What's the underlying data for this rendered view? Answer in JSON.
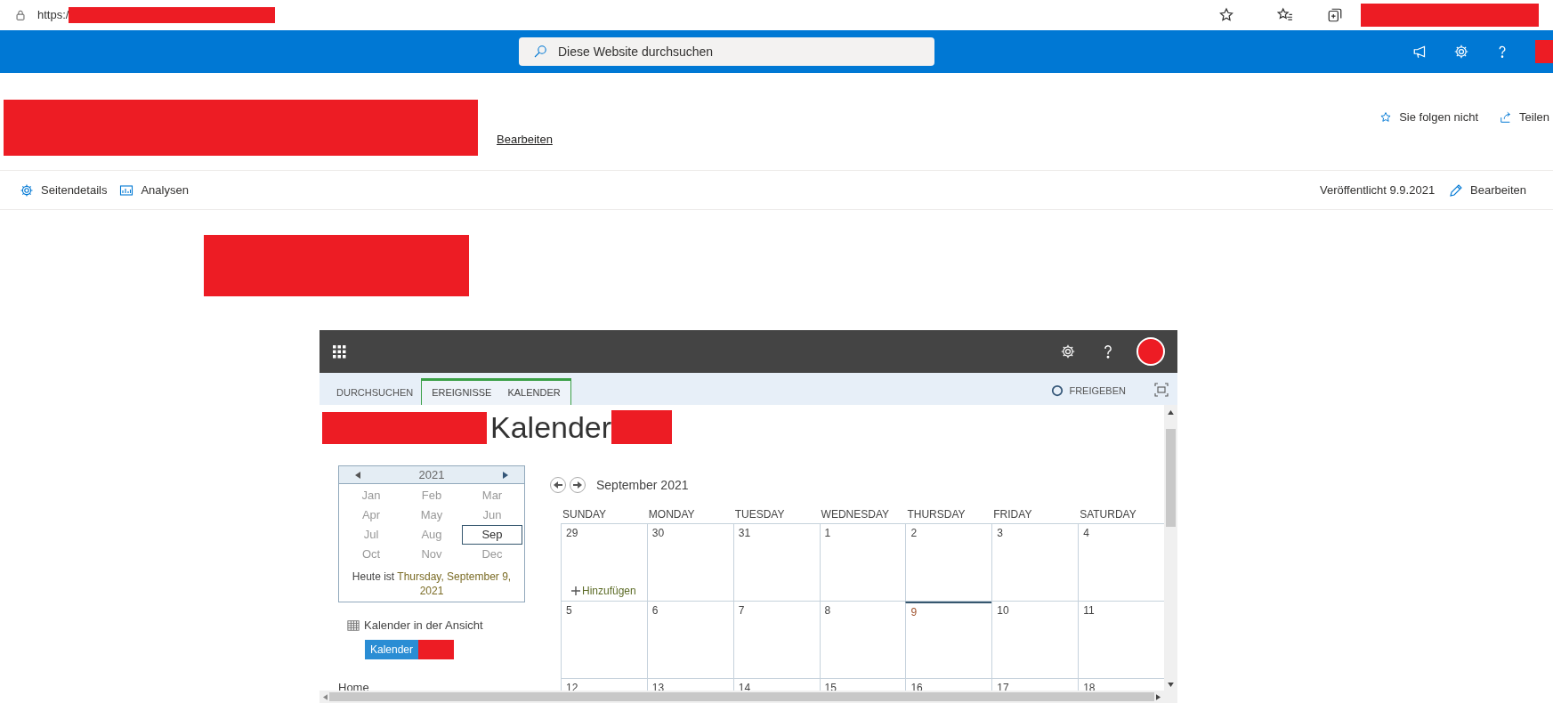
{
  "browser": {
    "url": "https:/"
  },
  "suite_bar": {
    "search_placeholder": "Diese Website durchsuchen"
  },
  "site_header": {
    "edit_link": "Bearbeiten",
    "follow": "Sie folgen nicht",
    "share": "Teilen"
  },
  "command_bar": {
    "items": [
      "Seitendetails",
      "Analysen"
    ],
    "published": "Veröffentlicht 9.9.2021",
    "edit": "Bearbeiten"
  },
  "app": {
    "tabs": [
      {
        "label": "DURCHSUCHEN",
        "contextual": false
      },
      {
        "label": "EREIGNISSE",
        "contextual": true
      },
      {
        "label": "KALENDER",
        "contextual": true
      }
    ],
    "share": "FREIGEBEN",
    "title": "Kalender",
    "year_picker": {
      "year": "2021",
      "months": [
        {
          "label": "Jan",
          "selected": false
        },
        {
          "label": "Feb",
          "selected": false
        },
        {
          "label": "Mar",
          "selected": false
        },
        {
          "label": "Apr",
          "selected": false
        },
        {
          "label": "May",
          "selected": false
        },
        {
          "label": "Jun",
          "selected": false
        },
        {
          "label": "Jul",
          "selected": false
        },
        {
          "label": "Aug",
          "selected": false
        },
        {
          "label": "Sep",
          "selected": true
        },
        {
          "label": "Oct",
          "selected": false
        },
        {
          "label": "Nov",
          "selected": false
        },
        {
          "label": "Dec",
          "selected": false
        }
      ],
      "today_prefix": "Heute ist",
      "today_date": "Thursday, September 9, 2021"
    },
    "views": {
      "heading": "Kalender in der Ansicht",
      "items": [
        {
          "label": "Kalender",
          "selected": true
        }
      ]
    },
    "nav": [
      "Home"
    ],
    "month": {
      "title": "September 2021",
      "weekdays": [
        "SUNDAY",
        "MONDAY",
        "TUESDAY",
        "WEDNESDAY",
        "THURSDAY",
        "FRIDAY",
        "SATURDAY"
      ],
      "weeks": [
        [
          {
            "day": "29",
            "today": false,
            "add_link": "Hinzufügen"
          },
          {
            "day": "30",
            "today": false
          },
          {
            "day": "31",
            "today": false
          },
          {
            "day": "1",
            "today": false
          },
          {
            "day": "2",
            "today": false
          },
          {
            "day": "3",
            "today": false
          },
          {
            "day": "4",
            "today": false
          }
        ],
        [
          {
            "day": "5",
            "today": false
          },
          {
            "day": "6",
            "today": false
          },
          {
            "day": "7",
            "today": false
          },
          {
            "day": "8",
            "today": false
          },
          {
            "day": "9",
            "today": true
          },
          {
            "day": "10",
            "today": false
          },
          {
            "day": "11",
            "today": false
          }
        ],
        [
          {
            "day": "12",
            "today": false
          },
          {
            "day": "13",
            "today": false
          },
          {
            "day": "14",
            "today": false
          },
          {
            "day": "15",
            "today": false
          },
          {
            "day": "16",
            "today": false
          },
          {
            "day": "17",
            "today": false
          },
          {
            "day": "18",
            "today": false
          }
        ]
      ]
    }
  }
}
